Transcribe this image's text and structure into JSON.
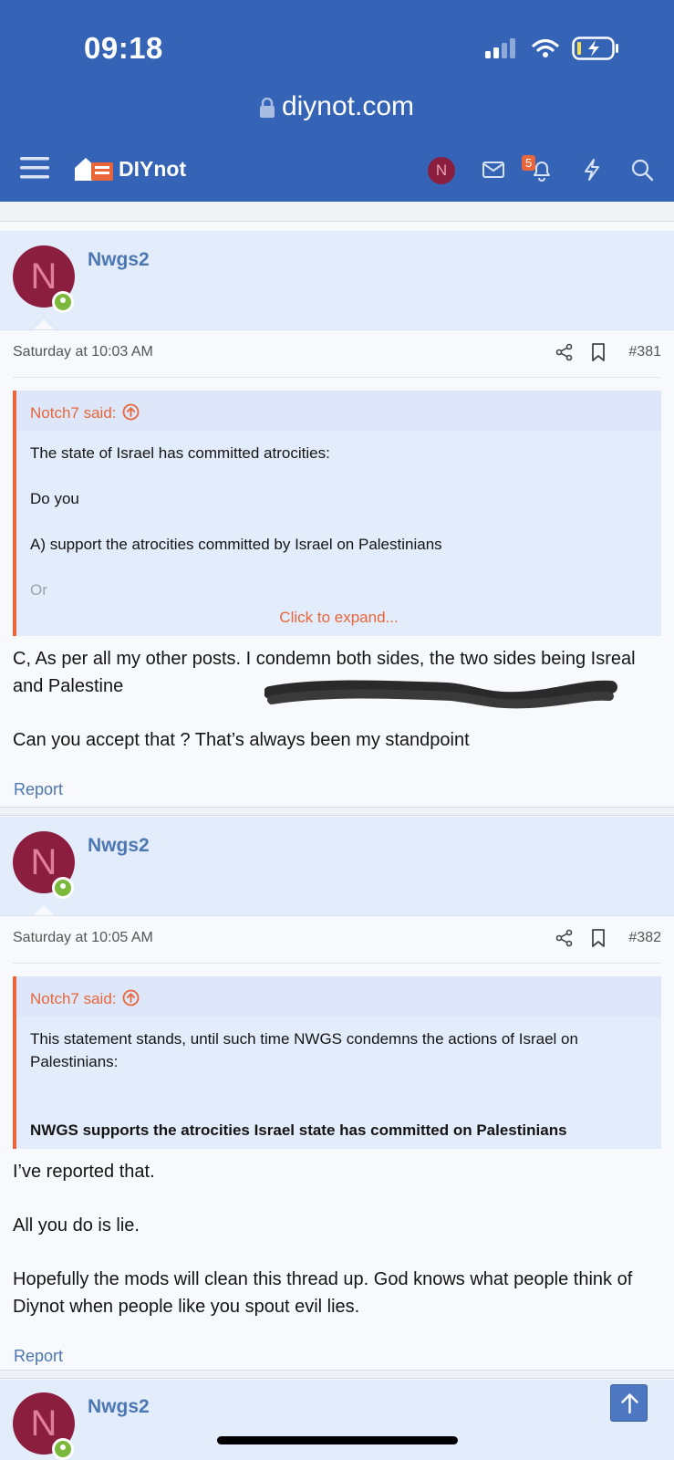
{
  "status_bar": {
    "time": "09:18"
  },
  "browser": {
    "url": "diynot.com"
  },
  "nav": {
    "logo_text": "DIYnot",
    "user_initial": "N",
    "alerts_count": "5"
  },
  "posts": [
    {
      "username": "Nwgs2",
      "avatar_initial": "N",
      "date": "Saturday at 10:03 AM",
      "number": "#381",
      "quote": {
        "author": "Notch7 said:",
        "lines": [
          "The state of Israel has committed atrocities:",
          "Do you",
          "A) support the atrocities committed by Israel on Palestinians",
          "Or"
        ],
        "expand_label": "Click to expand..."
      },
      "message": [
        "C, As per all my other posts. I condemn both sides, the two sides being Isreal and Palestine",
        "Can you accept that ? That’s always been my standpoint"
      ],
      "report_label": "Report"
    },
    {
      "username": "Nwgs2",
      "avatar_initial": "N",
      "date": "Saturday at 10:05 AM",
      "number": "#382",
      "quote": {
        "author": "Notch7 said:",
        "lines": [
          "This statement stands, until such time NWGS condemns the actions of Israel on Palestinians:",
          "NWGS supports the atrocities Israel state has committed on Palestinians"
        ]
      },
      "message": [
        "I’ve reported that.",
        "All you do is lie.",
        "Hopefully the mods will clean this thread up. God knows what people think of Diynot when people like you spout evil lies."
      ],
      "report_label": "Report"
    },
    {
      "username": "Nwgs2",
      "avatar_initial": "N"
    }
  ],
  "colors": {
    "header_blue": "#3563b6",
    "accent_orange": "#e8663a",
    "link_blue": "#4d77b3",
    "avatar_maroon": "#8b1e3f",
    "online_green": "#7cb83c"
  }
}
